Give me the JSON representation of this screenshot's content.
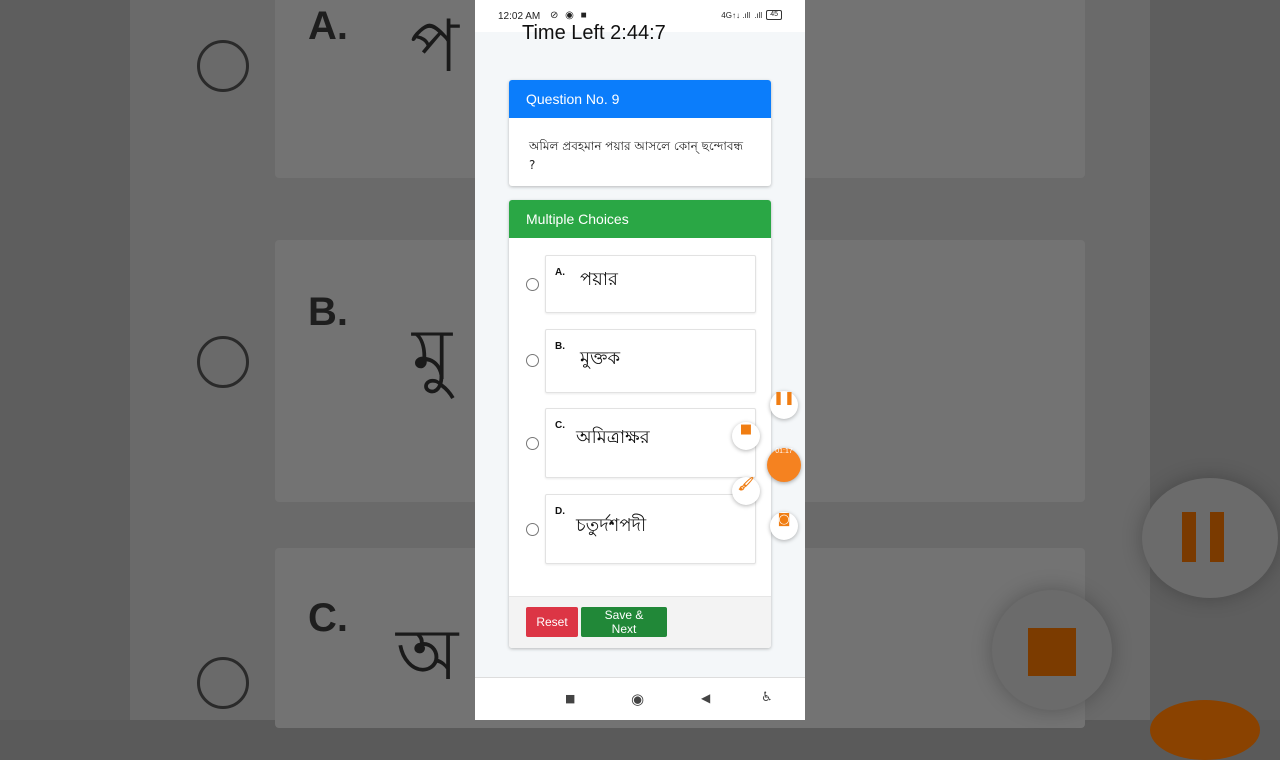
{
  "status_bar": {
    "time": "12:02 AM",
    "left_icons": "⊘ ◉ ■",
    "network_1": "4G↑↓ .ıll",
    "network_2": ".ıll",
    "battery": "45"
  },
  "timer": {
    "text": "Time Left 2:44:7"
  },
  "question": {
    "header": "Question No. 9",
    "text": "অমিল প্রবহমান পয়ার আসলে কোন্ ছন্দোবন্ধ ?"
  },
  "choices_panel": {
    "header": "Multiple Choices",
    "options": [
      {
        "letter": "A.",
        "text": "পয়ার"
      },
      {
        "letter": "B.",
        "text": "মুক্তক"
      },
      {
        "letter": "C.",
        "text": "অমিত্রাক্ষর"
      },
      {
        "letter": "D.",
        "text": "চতুর্দশপদী"
      }
    ],
    "reset_label": "Reset",
    "save_next_label": "Save & Next"
  },
  "recorder": {
    "pause_glyph": "❚❚",
    "stop_glyph": "■",
    "timer": "01:17",
    "brush_glyph": "🖌",
    "camera_glyph": "◙"
  },
  "nav_bar": {
    "square_glyph": "■",
    "home_glyph": "◉",
    "back_glyph": "◀",
    "accessibility_glyph": "♿"
  },
  "background": {
    "letters": [
      "A.",
      "B.",
      "C."
    ],
    "texts": [
      "প",
      "মু",
      "অ"
    ]
  },
  "colors": {
    "question_header": "#0b7dfb",
    "choices_header": "#2aa745",
    "reset": "#dc3545",
    "save_next": "#218838",
    "recorder_accent": "#f58220"
  }
}
